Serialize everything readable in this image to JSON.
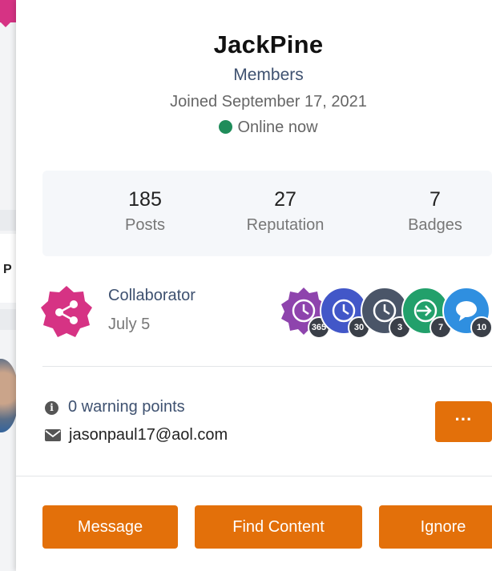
{
  "profile": {
    "name": "JackPine",
    "group": "Members",
    "joined": "Joined September 17, 2021",
    "status": "Online now"
  },
  "stats": [
    {
      "value": "185",
      "label": "Posts"
    },
    {
      "value": "27",
      "label": "Reputation"
    },
    {
      "value": "7",
      "label": "Badges"
    }
  ],
  "achievement": {
    "title": "Collaborator",
    "date": "July 5",
    "icon": "share-icon"
  },
  "badges": [
    {
      "icon": "clock-icon",
      "count": "365",
      "color": "#8e44ad"
    },
    {
      "icon": "clock-icon",
      "count": "30",
      "color": "#4257c8"
    },
    {
      "icon": "clock-icon",
      "count": "3",
      "color": "#4a5568"
    },
    {
      "icon": "signin-icon",
      "count": "7",
      "color": "#22a06b"
    },
    {
      "icon": "chat-icon",
      "count": "10",
      "color": "#2f8fe0"
    }
  ],
  "info": {
    "warning_points": "0 warning points",
    "email": "jasonpaul17@aol.com"
  },
  "actions": {
    "more_label": "···",
    "message": "Message",
    "find_content": "Find Content",
    "ignore": "Ignore"
  },
  "background": {
    "row_letter": "P"
  },
  "colors": {
    "accent": "#e3700a",
    "link": "#3e5170",
    "online": "#1f8c5a",
    "achievement": "#d63384"
  }
}
